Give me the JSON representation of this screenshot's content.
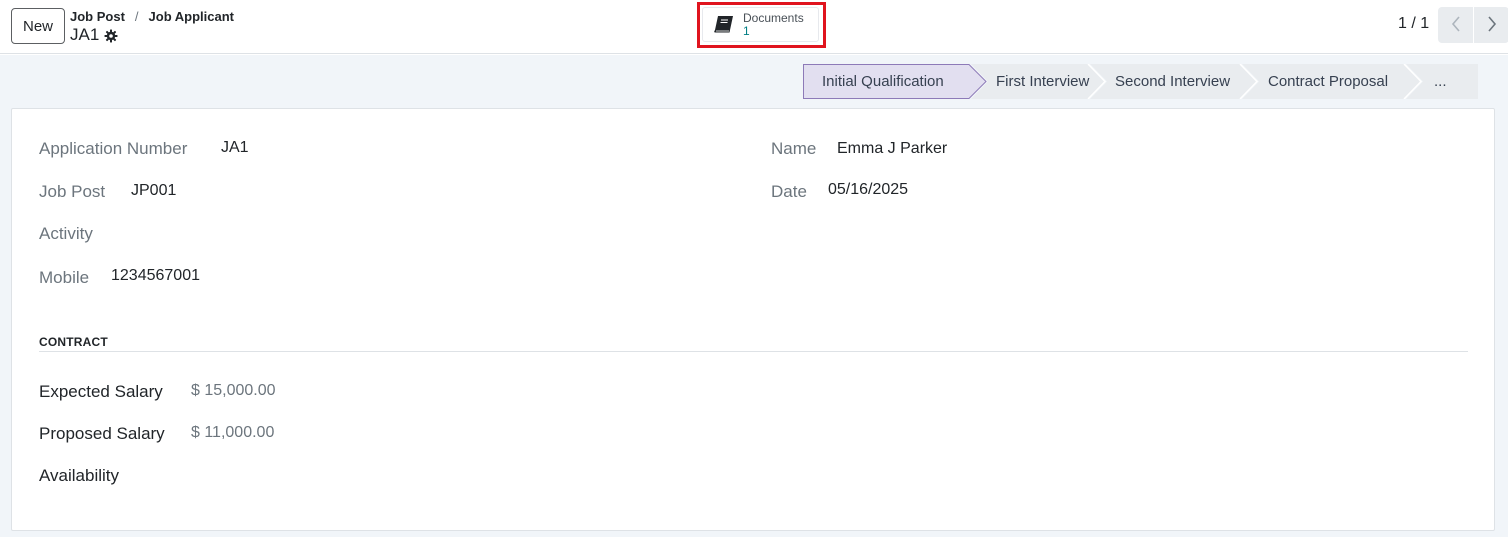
{
  "header": {
    "new_label": "New",
    "breadcrumb": {
      "parent": "Job Post",
      "separator": "/",
      "current": "Job Applicant"
    },
    "record_name": "JA1",
    "pager": {
      "value": "1 / 1"
    }
  },
  "smart_buttons": {
    "documents": {
      "label": "Documents",
      "count": "1"
    }
  },
  "statusbar": {
    "stages": [
      {
        "label": "Initial Qualification",
        "active": true
      },
      {
        "label": "First Interview",
        "active": false
      },
      {
        "label": "Second Interview",
        "active": false
      },
      {
        "label": "Contract Proposal",
        "active": false
      },
      {
        "label": "...",
        "active": false
      }
    ]
  },
  "form": {
    "application_number": {
      "label": "Application Number",
      "value": "JA1"
    },
    "job_post": {
      "label": "Job Post",
      "value": "JP001"
    },
    "activity": {
      "label": "Activity",
      "value": ""
    },
    "mobile": {
      "label": "Mobile",
      "value": "1234567001"
    },
    "name": {
      "label": "Name",
      "value": "Emma J Parker"
    },
    "date": {
      "label": "Date",
      "value": "05/16/2025"
    },
    "contract_section": "CONTRACT",
    "expected_salary": {
      "label": "Expected Salary",
      "value": "$ 15,000.00"
    },
    "proposed_salary": {
      "label": "Proposed Salary",
      "value": "$ 11,000.00"
    },
    "availability": {
      "label": "Availability",
      "value": ""
    }
  },
  "colors": {
    "highlight": "#e0141e",
    "active_stage": "#e2dff0",
    "active_stage_border": "#8d7ab8",
    "accent_teal": "#017e84"
  },
  "icons": {
    "gear": "gear-icon",
    "documents": "book-icon",
    "prev": "chevron-left-icon",
    "next": "chevron-right-icon"
  }
}
